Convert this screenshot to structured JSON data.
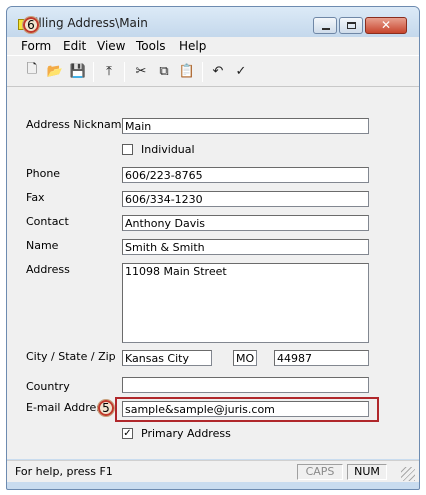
{
  "window": {
    "title": "Billing Address\\Main",
    "title_visible": "illing Address\\Main",
    "close_glyph": "✕"
  },
  "callouts": {
    "six": "6",
    "five": "5"
  },
  "menu": {
    "items": [
      "Form",
      "Edit",
      "View",
      "Tools",
      "Help"
    ]
  },
  "toolbar": {
    "icons": [
      "new-icon",
      "open-icon",
      "save-icon",
      "up-folder-icon",
      "cut-icon",
      "copy-icon",
      "paste-icon",
      "undo-icon",
      "spellcheck-icon"
    ],
    "glyphs": [
      "🗋",
      "📂",
      "💾",
      "⤒",
      "✂",
      "⧉",
      "📋",
      "↶",
      "✓"
    ]
  },
  "form": {
    "nickname_label": "Address Nickname",
    "nickname_value": "Main",
    "individual_label": "Individual",
    "individual_checked": false,
    "phone_label": "Phone",
    "phone_value": "606/223-8765",
    "fax_label": "Fax",
    "fax_value": "606/334-1230",
    "contact_label": "Contact",
    "contact_value": "Anthony Davis",
    "name_label": "Name",
    "name_value": "Smith & Smith",
    "address_label": "Address",
    "address_value": "11098 Main Street",
    "citystatezip_label": "City / State / Zip",
    "city_value": "Kansas City",
    "state_value": "MO",
    "zip_value": "44987",
    "country_label": "Country",
    "country_value": "",
    "email_label": "E-mail Address",
    "email_value": "sample&sample@juris.com",
    "primary_label": "Primary Address",
    "primary_checked": true,
    "check_glyph": "✓"
  },
  "status": {
    "help_text": "For help, press F1",
    "caps": "CAPS",
    "num": "NUM"
  },
  "colors": {
    "highlight": "#b0272b",
    "window_frame": "#c9dcef",
    "client_bg": "#f0f0f0"
  }
}
